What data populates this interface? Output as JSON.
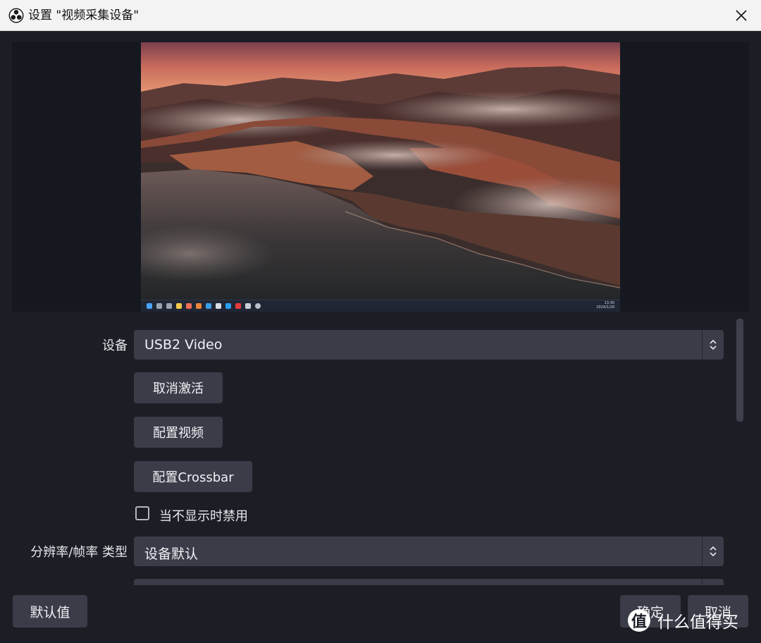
{
  "window": {
    "title": "设置 \"视频采集设备\"",
    "app_icon": "obs-icon",
    "close_icon": "close-icon"
  },
  "preview": {
    "content": "screen capture of a Windows 11 desktop: coastal mountain wallpaper",
    "clock_time": "13:30",
    "clock_date": "2024/1/18"
  },
  "properties": {
    "device_label": "设备",
    "device_value": "USB2 Video",
    "deactivate_button": "取消激活",
    "configure_video_button": "配置视频",
    "configure_crossbar_button": "配置Crossbar",
    "deactivate_when_hidden_label": "当不显示时禁用",
    "deactivate_when_hidden_checked": false,
    "resolution_label": "分辨率/帧率 类型",
    "resolution_value": "设备默认"
  },
  "footer": {
    "defaults_button": "默认值",
    "ok_button": "确定",
    "cancel_button": "取消"
  },
  "watermark": {
    "text": "什么值得买",
    "logo_char": "值"
  },
  "colors": {
    "background": "#1c1e26",
    "control": "#3a3c48",
    "titlebar": "#f3f3f3"
  }
}
